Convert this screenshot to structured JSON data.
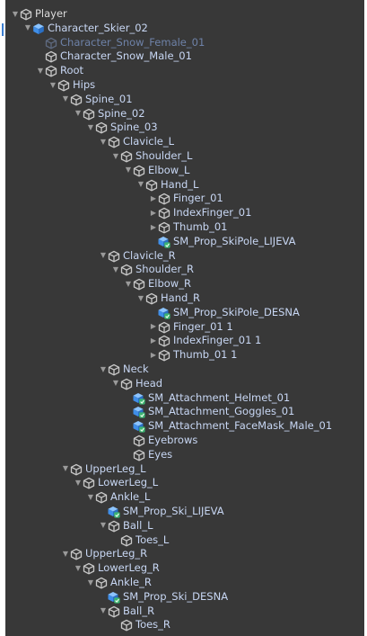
{
  "hierarchy": [
    {
      "label": "Player",
      "depth": 0,
      "arrow": "open",
      "icon": "gameobject",
      "style": "white"
    },
    {
      "label": "Character_Skier_02",
      "depth": 1,
      "arrow": "open",
      "icon": "prefab",
      "style": "normal"
    },
    {
      "label": "Character_Snow_Female_01",
      "depth": 2,
      "arrow": "none",
      "icon": "gameobject-dim",
      "style": "dim"
    },
    {
      "label": "Character_Snow_Male_01",
      "depth": 2,
      "arrow": "none",
      "icon": "gameobject",
      "style": "normal"
    },
    {
      "label": "Root",
      "depth": 2,
      "arrow": "open",
      "icon": "gameobject",
      "style": "normal"
    },
    {
      "label": "Hips",
      "depth": 3,
      "arrow": "open",
      "icon": "gameobject",
      "style": "normal"
    },
    {
      "label": "Spine_01",
      "depth": 4,
      "arrow": "open",
      "icon": "gameobject",
      "style": "normal"
    },
    {
      "label": "Spine_02",
      "depth": 5,
      "arrow": "open",
      "icon": "gameobject",
      "style": "normal"
    },
    {
      "label": "Spine_03",
      "depth": 6,
      "arrow": "open",
      "icon": "gameobject",
      "style": "normal"
    },
    {
      "label": "Clavicle_L",
      "depth": 7,
      "arrow": "open",
      "icon": "gameobject",
      "style": "normal"
    },
    {
      "label": "Shoulder_L",
      "depth": 8,
      "arrow": "open",
      "icon": "gameobject",
      "style": "normal"
    },
    {
      "label": "Elbow_L",
      "depth": 9,
      "arrow": "open",
      "icon": "gameobject",
      "style": "normal"
    },
    {
      "label": "Hand_L",
      "depth": 10,
      "arrow": "open",
      "icon": "gameobject",
      "style": "normal"
    },
    {
      "label": "Finger_01",
      "depth": 11,
      "arrow": "closed",
      "icon": "gameobject",
      "style": "normal"
    },
    {
      "label": "IndexFinger_01",
      "depth": 11,
      "arrow": "closed",
      "icon": "gameobject",
      "style": "normal"
    },
    {
      "label": "Thumb_01",
      "depth": 11,
      "arrow": "closed",
      "icon": "gameobject",
      "style": "normal"
    },
    {
      "label": "SM_Prop_SkiPole_LIJEVA",
      "depth": 11,
      "arrow": "none",
      "icon": "prefab-model",
      "style": "normal"
    },
    {
      "label": "Clavicle_R",
      "depth": 7,
      "arrow": "open",
      "icon": "gameobject",
      "style": "normal"
    },
    {
      "label": "Shoulder_R",
      "depth": 8,
      "arrow": "open",
      "icon": "gameobject",
      "style": "normal"
    },
    {
      "label": "Elbow_R",
      "depth": 9,
      "arrow": "open",
      "icon": "gameobject",
      "style": "normal"
    },
    {
      "label": "Hand_R",
      "depth": 10,
      "arrow": "open",
      "icon": "gameobject",
      "style": "normal"
    },
    {
      "label": "SM_Prop_SkiPole_DESNA",
      "depth": 11,
      "arrow": "none",
      "icon": "prefab-model",
      "style": "normal"
    },
    {
      "label": "Finger_01 1",
      "depth": 11,
      "arrow": "closed",
      "icon": "gameobject",
      "style": "normal"
    },
    {
      "label": "IndexFinger_01 1",
      "depth": 11,
      "arrow": "closed",
      "icon": "gameobject",
      "style": "normal"
    },
    {
      "label": "Thumb_01 1",
      "depth": 11,
      "arrow": "closed",
      "icon": "gameobject",
      "style": "normal"
    },
    {
      "label": "Neck",
      "depth": 7,
      "arrow": "open",
      "icon": "gameobject",
      "style": "normal"
    },
    {
      "label": "Head",
      "depth": 8,
      "arrow": "open",
      "icon": "gameobject",
      "style": "normal"
    },
    {
      "label": "SM_Attachment_Helmet_01",
      "depth": 9,
      "arrow": "none",
      "icon": "prefab-model",
      "style": "normal"
    },
    {
      "label": "SM_Attachment_Goggles_01",
      "depth": 9,
      "arrow": "none",
      "icon": "prefab-model",
      "style": "normal"
    },
    {
      "label": "SM_Attachment_FaceMask_Male_01",
      "depth": 9,
      "arrow": "none",
      "icon": "prefab-model",
      "style": "normal"
    },
    {
      "label": "Eyebrows",
      "depth": 9,
      "arrow": "none",
      "icon": "gameobject",
      "style": "normal"
    },
    {
      "label": "Eyes",
      "depth": 9,
      "arrow": "none",
      "icon": "gameobject",
      "style": "normal"
    },
    {
      "label": "UpperLeg_L",
      "depth": 4,
      "arrow": "open",
      "icon": "gameobject",
      "style": "normal"
    },
    {
      "label": "LowerLeg_L",
      "depth": 5,
      "arrow": "open",
      "icon": "gameobject",
      "style": "normal"
    },
    {
      "label": "Ankle_L",
      "depth": 6,
      "arrow": "open",
      "icon": "gameobject",
      "style": "normal"
    },
    {
      "label": "SM_Prop_Ski_LIJEVA",
      "depth": 7,
      "arrow": "none",
      "icon": "prefab-model",
      "style": "normal"
    },
    {
      "label": "Ball_L",
      "depth": 7,
      "arrow": "open",
      "icon": "gameobject",
      "style": "normal"
    },
    {
      "label": "Toes_L",
      "depth": 8,
      "arrow": "none",
      "icon": "gameobject",
      "style": "normal"
    },
    {
      "label": "UpperLeg_R",
      "depth": 4,
      "arrow": "open",
      "icon": "gameobject",
      "style": "normal"
    },
    {
      "label": "LowerLeg_R",
      "depth": 5,
      "arrow": "open",
      "icon": "gameobject",
      "style": "normal"
    },
    {
      "label": "Ankle_R",
      "depth": 6,
      "arrow": "open",
      "icon": "gameobject",
      "style": "normal"
    },
    {
      "label": "SM_Prop_Ski_DESNA",
      "depth": 7,
      "arrow": "none",
      "icon": "prefab-model",
      "style": "normal"
    },
    {
      "label": "Ball_R",
      "depth": 7,
      "arrow": "open",
      "icon": "gameobject",
      "style": "normal"
    },
    {
      "label": "Toes_R",
      "depth": 8,
      "arrow": "none",
      "icon": "gameobject",
      "style": "normal"
    }
  ],
  "colors": {
    "panel_bg": "#383838",
    "label_normal": "#c8d7f4",
    "label_dim": "#6e82a8",
    "label_white": "#dcdcdc",
    "prefab_blue": "#5aa0f0",
    "model_green": "#3cb371"
  }
}
